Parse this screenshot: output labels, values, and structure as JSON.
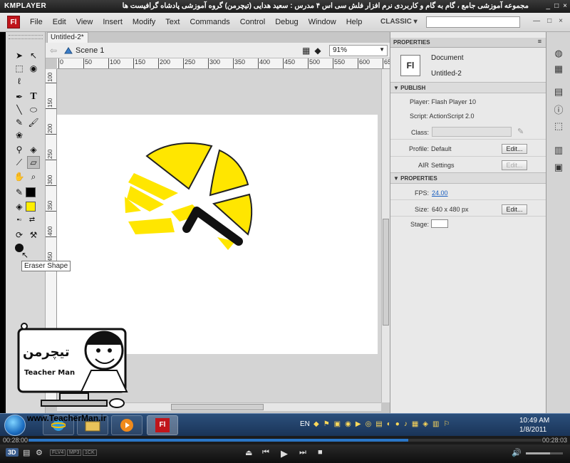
{
  "kmplayer": {
    "logo": "KMPLAYER",
    "title": "مجموعه آموزشی جامع ، گام به گام و کاربردی نرم افزار فلش سی اس ۴ مدرس : سعید هدایی (تیچرمن) گروه آموزشی پادشاه گرافیست ها",
    "win_buttons": [
      "_",
      "□",
      "×"
    ],
    "time_current": "00:28:00",
    "time_total": "00:28:03",
    "badges": [
      "FLV4",
      "MP3",
      "1CK"
    ],
    "progress": 0.74,
    "volume": 0.65
  },
  "app": {
    "logo_text": "Fl",
    "menu": [
      "File",
      "Edit",
      "View",
      "Insert",
      "Modify",
      "Text",
      "Commands",
      "Control",
      "Debug",
      "Window",
      "Help"
    ],
    "workspace": "CLASSIC ▾",
    "window_buttons": [
      "—",
      "□",
      "×"
    ]
  },
  "tools": {
    "tooltip": "Eraser Shape",
    "colors": {
      "stroke": "#000000",
      "fill": "#ffee00"
    }
  },
  "document": {
    "tab": "Untitled-2*",
    "scene": "Scene 1",
    "zoom": "91%",
    "ruler_h": [
      "0",
      "50",
      "100",
      "150",
      "200",
      "250",
      "300",
      "350",
      "400",
      "450",
      "500",
      "550",
      "600",
      "65"
    ],
    "ruler_v": [
      "100",
      "150",
      "200",
      "250",
      "300",
      "350",
      "400",
      "450"
    ]
  },
  "overlay": {
    "brand": "تیچرمن",
    "brand_sub": "Teacher Man",
    "url": "www.TeacherMan.ir"
  },
  "properties": {
    "tab": "PROPERTIES",
    "menu_icon": "≡",
    "doc_icon": "Fl",
    "doc_type": "Document",
    "doc_name": "Untitled-2",
    "publish_header": "PUBLISH",
    "player": "Player: Flash Player 10",
    "script": "Script: ActionScript 2.0",
    "class_label": "Class:",
    "profile_label": "Profile:",
    "profile_value": "Default",
    "edit_label": "Edit...",
    "air_label": "AIR",
    "air_settings": "Settings",
    "props_header": "PROPERTIES",
    "fps_label": "FPS:",
    "fps_value": "24.00",
    "size_label": "Size:",
    "size_value": "640 x 480 px",
    "stage_label": "Stage:"
  },
  "taskbar": {
    "lang": "EN",
    "time": "10:49 AM",
    "date": "1/8/2011"
  }
}
